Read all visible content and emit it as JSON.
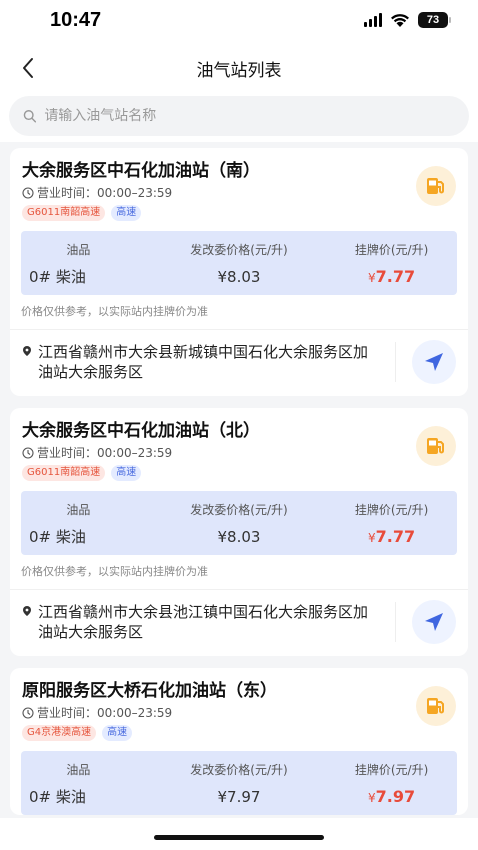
{
  "status": {
    "time": "10:47",
    "battery": "73"
  },
  "nav": {
    "title": "油气站列表"
  },
  "search": {
    "placeholder": "请输入油气站名称"
  },
  "price_headers": {
    "product": "油品",
    "ndrc_price": "发改委价格(元/升)",
    "listed_price": "挂牌价(元/升)"
  },
  "stations": [
    {
      "name": "大余服务区中石化加油站（南）",
      "hours": "营业时间：00:00–23:59",
      "road_tag": "G6011南韶高速",
      "type_tag": "高速",
      "fuel": "0# 柴油",
      "ndrc_price": "¥8.03",
      "listed_currency": "¥",
      "listed_price": "7.77",
      "note": "价格仅供参考，以实际站内挂牌价为准",
      "address": "江西省赣州市大余县新城镇中国石化大余服务区加油站大余服务区"
    },
    {
      "name": "大余服务区中石化加油站（北）",
      "hours": "营业时间：00:00–23:59",
      "road_tag": "G6011南韶高速",
      "type_tag": "高速",
      "fuel": "0# 柴油",
      "ndrc_price": "¥8.03",
      "listed_currency": "¥",
      "listed_price": "7.77",
      "note": "价格仅供参考，以实际站内挂牌价为准",
      "address": "江西省赣州市大余县池江镇中国石化大余服务区加油站大余服务区"
    },
    {
      "name": "原阳服务区大桥石化加油站（东）",
      "hours": "营业时间：00:00–23:59",
      "road_tag": "G4京港澳高速",
      "type_tag": "高速",
      "fuel": "0# 柴油",
      "ndrc_price": "¥7.97",
      "listed_currency": "¥",
      "listed_price": "7.97"
    }
  ],
  "colors": {
    "accent_red": "#e84b3a",
    "accent_blue": "#3f66e0",
    "fuel_orange": "#f5a623"
  },
  "icons": [
    "back-icon",
    "search-icon",
    "clock-icon",
    "fuel-pump-icon",
    "location-pin-icon",
    "navigate-arrow-icon"
  ]
}
